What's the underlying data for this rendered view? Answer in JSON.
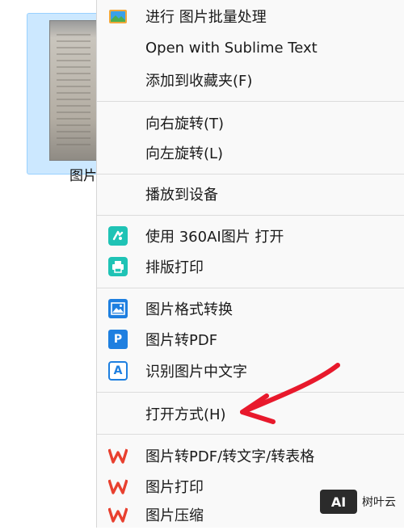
{
  "file": {
    "label": "图片"
  },
  "menu": {
    "items": [
      {
        "label": "进行 图片批量处理",
        "icon": "envelope-image-icon"
      },
      {
        "label": "Open with Sublime Text",
        "icon": ""
      },
      {
        "label": "添加到收藏夹(F)",
        "icon": ""
      },
      {
        "label": "向右旋转(T)",
        "icon": ""
      },
      {
        "label": "向左旋转(L)",
        "icon": ""
      },
      {
        "label": "播放到设备",
        "icon": ""
      },
      {
        "label": "使用 360AI图片 打开",
        "icon": "360ai-icon"
      },
      {
        "label": "排版打印",
        "icon": "printer-icon"
      },
      {
        "label": "图片格式转换",
        "icon": "image-icon"
      },
      {
        "label": "图片转PDF",
        "icon": "pdf-icon"
      },
      {
        "label": "识别图片中文字",
        "icon": "ocr-icon"
      },
      {
        "label": "打开方式(H)",
        "icon": ""
      },
      {
        "label": "图片转PDF/转文字/转表格",
        "icon": "wps-icon"
      },
      {
        "label": "图片打印",
        "icon": "wps-icon"
      },
      {
        "label": "图片压缩",
        "icon": "wps-icon"
      }
    ],
    "icon_glyphs": {
      "pdf": "P",
      "ocr": "A"
    }
  },
  "watermark": {
    "badge": "AI",
    "text": "树叶云"
  },
  "colors": {
    "selection_bg": "#cce8ff",
    "menu_bg": "#f9f9f9",
    "accent_teal": "#1fc3b5",
    "accent_blue": "#1e7fe0",
    "wps_red": "#e8402f",
    "arrow_red": "#e8192c"
  }
}
